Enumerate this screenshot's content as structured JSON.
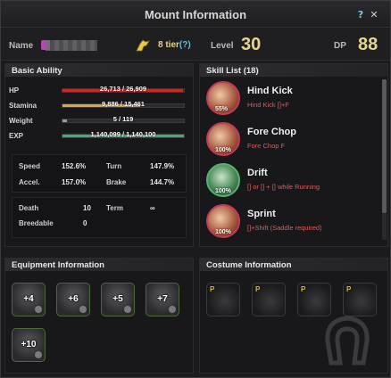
{
  "window": {
    "title": "Mount Information",
    "help_label": "?",
    "close_label": "✕"
  },
  "header": {
    "name_label": "Name",
    "tier": "8 tier",
    "tier_q": "(?)",
    "level_label": "Level",
    "level": "30",
    "dp_label": "DP",
    "dp": "88"
  },
  "basic_ability": {
    "title": "Basic Ability",
    "bars": [
      {
        "label": "HP",
        "value": "26,713 / 26,909",
        "fraction": 0.993,
        "color": "#c42a2a"
      },
      {
        "label": "Stamina",
        "value": "9,886 / 15,461",
        "fraction": 0.64,
        "color": "#e8a23a"
      },
      {
        "label": "Weight",
        "value": "5 / 119",
        "fraction": 0.04,
        "color": "#9a9a9a"
      },
      {
        "label": "EXP",
        "value": "1,140,099 / 1,140,100",
        "fraction": 0.999,
        "color": "#3ab07a"
      }
    ],
    "stats": {
      "speed_label": "Speed",
      "speed": "152.6%",
      "turn_label": "Turn",
      "turn": "147.9%",
      "accel_label": "Accel.",
      "accel": "157.0%",
      "brake_label": "Brake",
      "brake": "144.7%"
    },
    "misc": {
      "death_label": "Death",
      "death": "10",
      "term_label": "Term",
      "term": "∞",
      "breedable_label": "Breedable",
      "breedable": "0"
    }
  },
  "skills": {
    "title": "Skill List",
    "count": "(18)",
    "items": [
      {
        "name": "Hind Kick",
        "key": "Hind Kick []+F",
        "pct": "55%",
        "style": "red"
      },
      {
        "name": "Fore Chop",
        "key": "Fore Chop F",
        "pct": "100%",
        "style": "red"
      },
      {
        "name": "Drift",
        "key": "[] or [] + [] while Running",
        "pct": "100%",
        "style": "green"
      },
      {
        "name": "Sprint",
        "key": "[]+Shift (Saddle required)",
        "pct": "100%",
        "style": "red"
      }
    ]
  },
  "equipment": {
    "title": "Equipment Information",
    "slots": [
      "+4",
      "+6",
      "+5",
      "+7",
      "+10"
    ]
  },
  "costume": {
    "title": "Costume Information",
    "badge": "P"
  }
}
